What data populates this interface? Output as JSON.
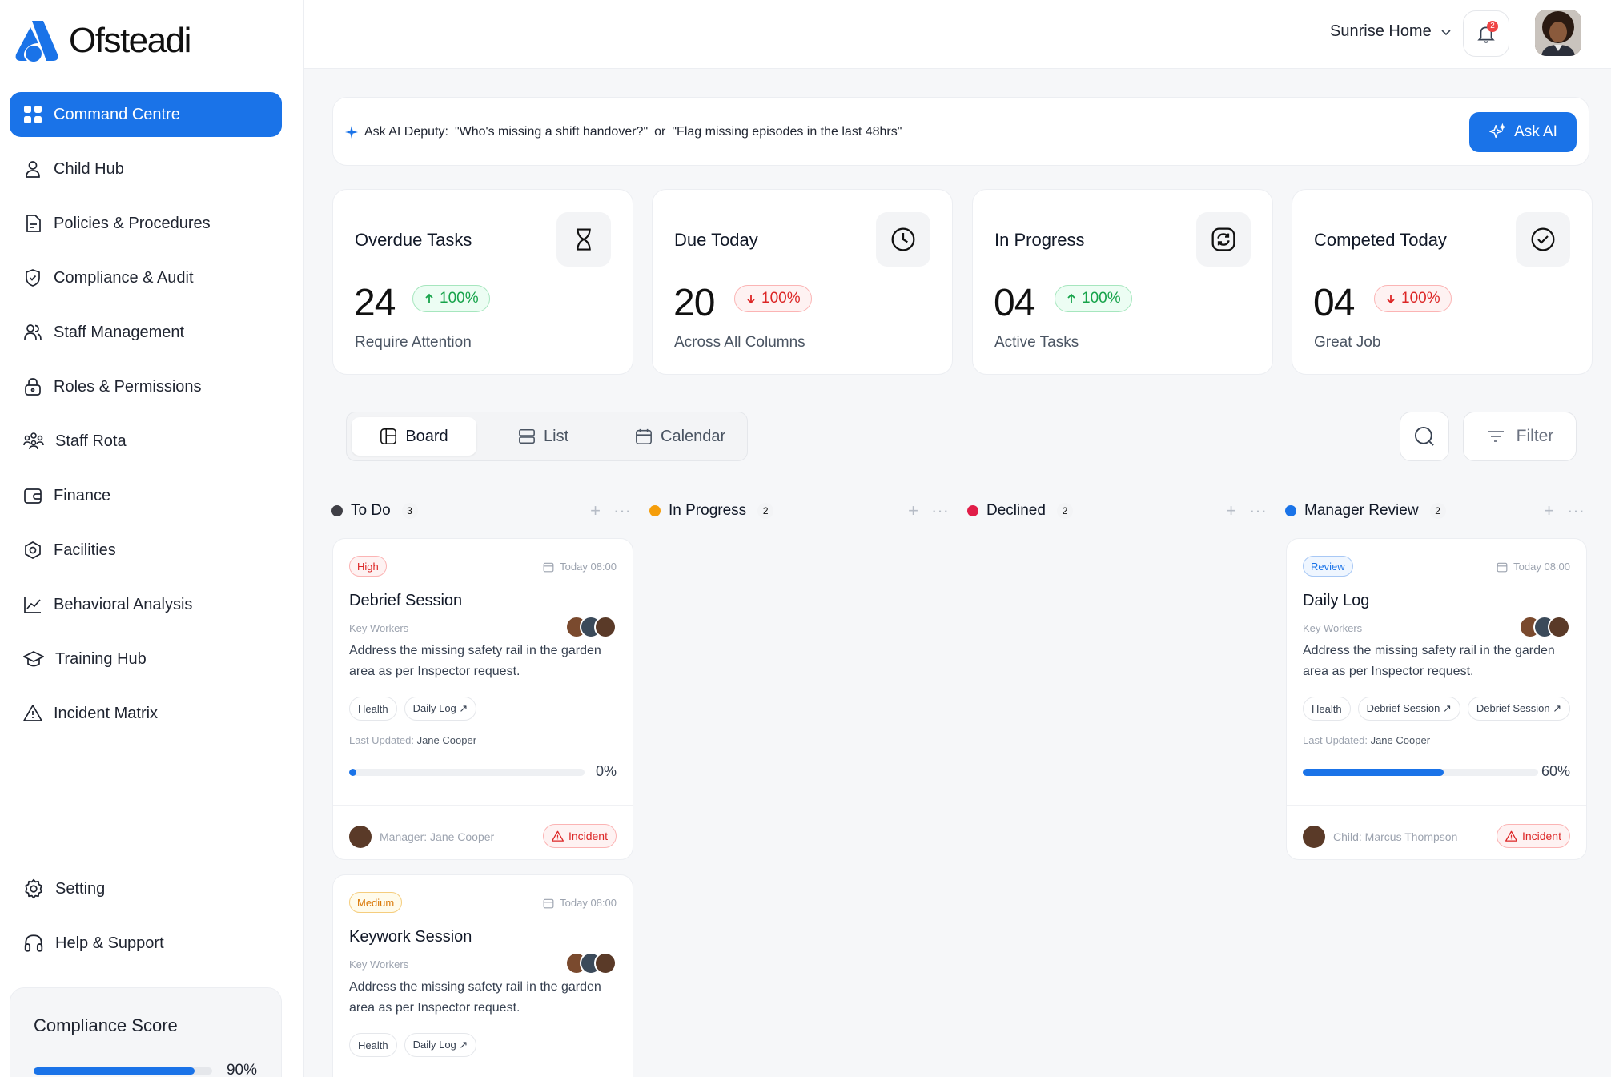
{
  "app": {
    "name": "Ofsteadi"
  },
  "sidebar": {
    "items": [
      {
        "label": "Command Centre",
        "icon": "grid-icon",
        "active": true
      },
      {
        "label": "Child Hub",
        "icon": "user-icon"
      },
      {
        "label": "Policies & Procedures",
        "icon": "document-icon"
      },
      {
        "label": "Compliance & Audit",
        "icon": "shield-check-icon"
      },
      {
        "label": "Staff Management",
        "icon": "users-icon"
      },
      {
        "label": "Roles & Permissions",
        "icon": "lock-icon"
      },
      {
        "label": "Staff Rota",
        "icon": "people-group-icon"
      },
      {
        "label": "Finance",
        "icon": "wallet-icon"
      },
      {
        "label": "Facilities",
        "icon": "hexagon-icon"
      },
      {
        "label": "Behavioral Analysis",
        "icon": "chart-line-icon"
      },
      {
        "label": "Training Hub",
        "icon": "graduation-cap-icon"
      },
      {
        "label": "Incident Matrix",
        "icon": "warning-icon"
      }
    ],
    "bottom": [
      {
        "label": "Setting",
        "icon": "gear-icon"
      },
      {
        "label": "Help & Support",
        "icon": "headset-icon"
      }
    ],
    "compliance": {
      "title": "Compliance Score",
      "value": 90,
      "label": "90%"
    }
  },
  "header": {
    "location": "Sunrise Home",
    "notifications": "2",
    "accent": "#1a73e8"
  },
  "ai": {
    "prompt_label": "Ask AI Deputy:",
    "example_1": "\"Who's missing a shift handover?\"",
    "or": "or",
    "example_2": "\"Flag missing episodes in the last 48hrs\"",
    "button": "Ask AI"
  },
  "stats": [
    {
      "title": "Overdue Tasks",
      "value": "24",
      "delta": "100%",
      "direction": "up",
      "subtitle": "Require Attention",
      "icon": "hourglass-icon"
    },
    {
      "title": "Due Today",
      "value": "20",
      "delta": "100%",
      "direction": "down",
      "subtitle": "Across All Columns",
      "icon": "clock-icon"
    },
    {
      "title": "In Progress",
      "value": "04",
      "delta": "100%",
      "direction": "up",
      "subtitle": "Active Tasks",
      "icon": "refresh-icon"
    },
    {
      "title": "Competed Today",
      "value": "04",
      "delta": "100%",
      "direction": "down",
      "subtitle": "Great Job",
      "icon": "check-circle-icon"
    }
  ],
  "views": {
    "board": "Board",
    "list": "List",
    "calendar": "Calendar",
    "active": "board"
  },
  "filter": {
    "label": "Filter"
  },
  "columns": [
    {
      "name": "To Do",
      "count": "3",
      "color": "#3f3f46"
    },
    {
      "name": "In Progress",
      "count": "2",
      "color": "#f59e0b"
    },
    {
      "name": "Declined",
      "count": "2",
      "color": "#e11d48"
    },
    {
      "name": "Manager Review",
      "count": "2",
      "color": "#1a73e8"
    }
  ],
  "tasks": [
    {
      "priority": "High",
      "date": "Today 08:00",
      "title": "Debrief Session",
      "role": "Key Workers",
      "description": "Address the missing safety rail in the garden area as per Inspector request.",
      "chips": [
        "Health",
        "Daily Log ↗"
      ],
      "updated_label": "Last Updated:",
      "updated_by": "Jane Cooper",
      "progress": 0,
      "progress_label": "0%",
      "footer": "Manager: Jane Cooper",
      "badge": "Incident"
    },
    {
      "priority": "Medium",
      "date": "Today 08:00",
      "title": "Keywork Session",
      "role": "Key Workers",
      "description": "Address the missing safety rail in the garden area as per Inspector request.",
      "chips": [
        "Health",
        "Daily Log ↗"
      ]
    },
    {
      "priority": "Review",
      "date": "Today 08:00",
      "title": "Daily Log",
      "role": "Key Workers",
      "description": "Address the missing safety rail in the garden area as per Inspector request.",
      "chips": [
        "Health",
        "Debrief Session ↗",
        "Debrief Session ↗"
      ],
      "updated_label": "Last Updated:",
      "updated_by": "Jane Cooper",
      "progress": 60,
      "progress_label": "60%",
      "footer": "Child: Marcus Thompson",
      "badge": "Incident"
    }
  ]
}
